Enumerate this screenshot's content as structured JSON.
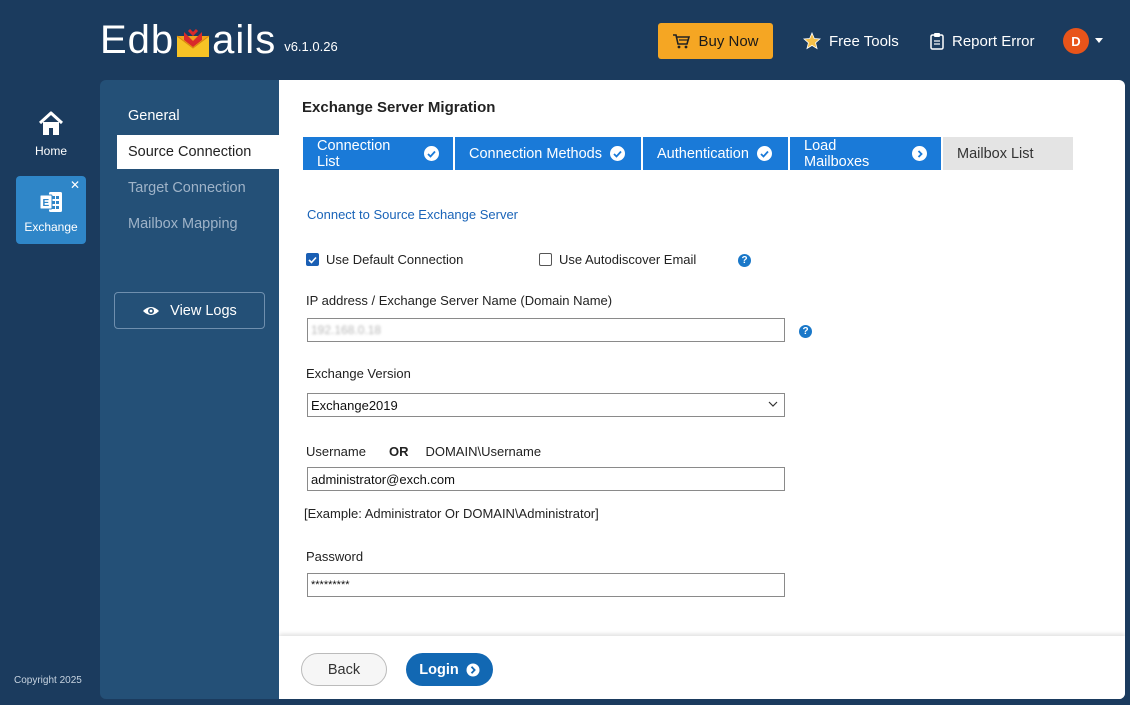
{
  "app": {
    "logo_left": "Edb",
    "logo_right": "ails",
    "version": "v6.1.0.26"
  },
  "header": {
    "buy_now": "Buy Now",
    "free_tools": "Free Tools",
    "report_error": "Report Error",
    "avatar_initial": "D"
  },
  "rail": {
    "home": "Home",
    "exchange": "Exchange",
    "close": "✕",
    "copyright": "Copyright 2025"
  },
  "subnav": {
    "items": [
      "General",
      "Source Connection",
      "Target Connection",
      "Mailbox Mapping"
    ],
    "view_logs": "View Logs"
  },
  "main": {
    "title": "Exchange Server Migration",
    "steps": [
      {
        "label": "Connection List",
        "state": "done"
      },
      {
        "label": "Connection Methods",
        "state": "done"
      },
      {
        "label": "Authentication",
        "state": "done"
      },
      {
        "label": "Load Mailboxes",
        "state": "current"
      },
      {
        "label": "Mailbox List",
        "state": "pending"
      }
    ],
    "section_link": "Connect to Source Exchange Server",
    "use_default": "Use Default Connection",
    "use_autodiscover": "Use Autodiscover Email",
    "ip_label": "IP address / Exchange Server Name (Domain Name)",
    "ip_value": "192.168.0.18",
    "version_label": "Exchange Version",
    "version_value": "Exchange2019",
    "username_label": "Username",
    "username_or": "OR",
    "username_domain": "DOMAIN\\Username",
    "username_value": "administrator@exch.com",
    "username_hint": "[Example: Administrator Or DOMAIN\\Administrator]",
    "password_label": "Password",
    "password_value": "*********",
    "back": "Back",
    "login": "Login"
  },
  "colors": {
    "background": "#1b3b5e",
    "sidebar": "#245077",
    "accent": "#1a7ad8",
    "buy": "#f5a623",
    "avatar": "#e8541a"
  }
}
